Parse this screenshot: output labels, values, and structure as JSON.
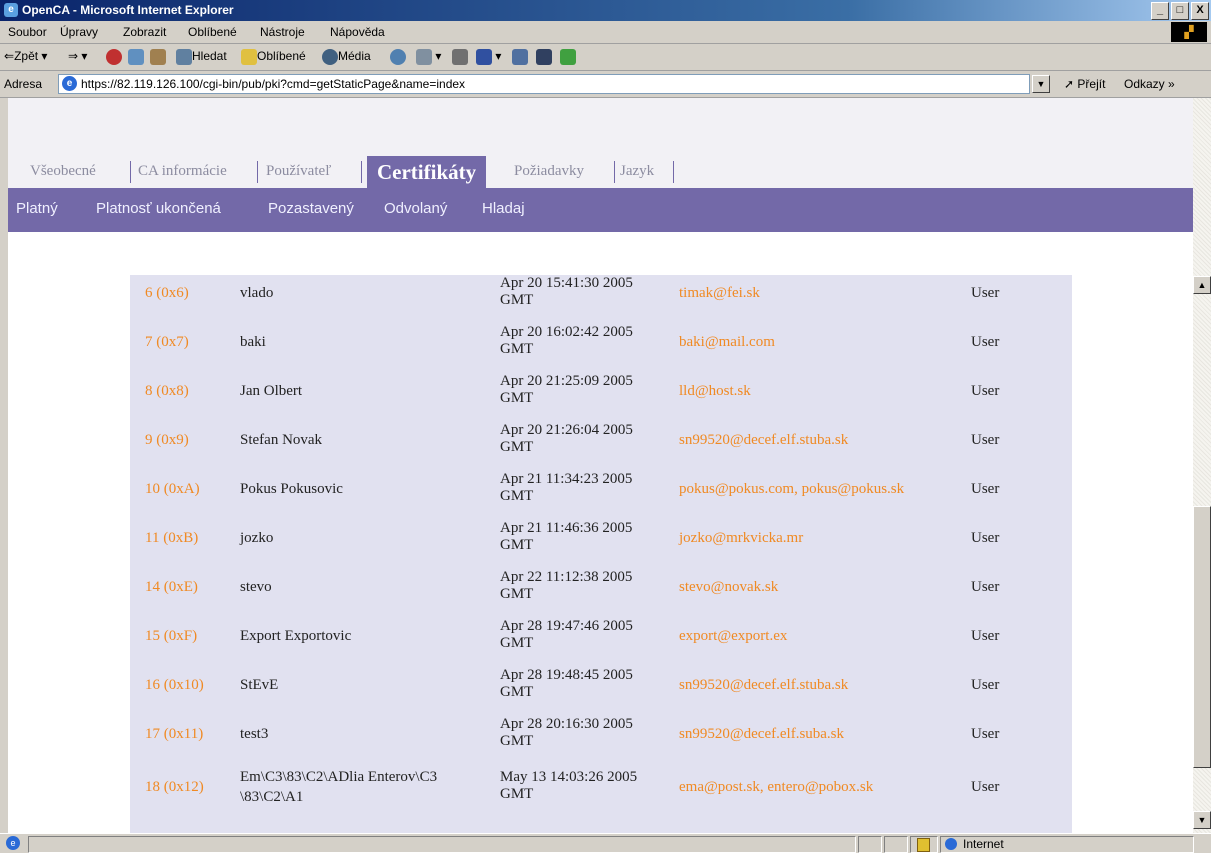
{
  "window": {
    "title": "OpenCA - Microsoft Internet Explorer",
    "min": "_",
    "max": "×",
    "restore": "□",
    "close": "X",
    "icon_glyph": "e"
  },
  "menu": [
    "Soubor",
    "Úpravy",
    "Zobrazit",
    "Oblíbené",
    "Nástroje",
    "Nápověda"
  ],
  "toolbar": {
    "back": "Zpět",
    "search": "Hledat",
    "favorites": "Oblíbené",
    "media": "Média"
  },
  "address": {
    "label": "Adresa",
    "url": "https://82.119.126.100/cgi-bin/pub/pki?cmd=getStaticPage&name=index",
    "go": "Přejít",
    "links": "Odkazy »"
  },
  "tabs": [
    "Všeobecné",
    "CA informácie",
    "Používateľ",
    "Certifikáty",
    "Požiadavky",
    "Jazyk"
  ],
  "active_tab": "Certifikáty",
  "subnav": [
    "Platný",
    "Platnosť ukončená",
    "Pozastavený",
    "Odvolaný",
    "Hladaj"
  ],
  "colors": {
    "nav": "#7369a8",
    "link": "#f08a24",
    "table_bg": "#e1e1f0"
  },
  "rows": [
    {
      "serial": "6 (0x6)",
      "name": "vlado",
      "date1": "Apr 20 15:41:30 2005",
      "date2": "GMT",
      "email": "timak@fei.sk",
      "role": "User"
    },
    {
      "serial": "7 (0x7)",
      "name": "baki",
      "date1": "Apr 20 16:02:42 2005",
      "date2": "GMT",
      "email": "baki@mail.com",
      "role": "User"
    },
    {
      "serial": "8 (0x8)",
      "name": "Jan Olbert",
      "date1": "Apr 20 21:25:09 2005",
      "date2": "GMT",
      "email": "lld@host.sk",
      "role": "User"
    },
    {
      "serial": "9 (0x9)",
      "name": "Stefan Novak",
      "date1": "Apr 20 21:26:04 2005",
      "date2": "GMT",
      "email": "sn99520@decef.elf.stuba.sk",
      "role": "User"
    },
    {
      "serial": "10 (0xA)",
      "name": "Pokus Pokusovic",
      "date1": "Apr 21 11:34:23 2005",
      "date2": "GMT",
      "email": "pokus@pokus.com, pokus@pokus.sk",
      "role": "User"
    },
    {
      "serial": "11 (0xB)",
      "name": "jozko",
      "date1": "Apr 21 11:46:36 2005",
      "date2": "GMT",
      "email": "jozko@mrkvicka.mr",
      "role": "User"
    },
    {
      "serial": "14 (0xE)",
      "name": "stevo",
      "date1": "Apr 22 11:12:38 2005",
      "date2": "GMT",
      "email": "stevo@novak.sk",
      "role": "User"
    },
    {
      "serial": "15 (0xF)",
      "name": "Export Exportovic",
      "date1": "Apr 28 19:47:46 2005",
      "date2": "GMT",
      "email": "export@export.ex",
      "role": "User"
    },
    {
      "serial": "16 (0x10)",
      "name": "StEvE",
      "date1": "Apr 28 19:48:45 2005",
      "date2": "GMT",
      "email": "sn99520@decef.elf.stuba.sk",
      "role": "User"
    },
    {
      "serial": "17 (0x11)",
      "name": "test3",
      "date1": "Apr 28 20:16:30 2005",
      "date2": "GMT",
      "email": "sn99520@decef.elf.suba.sk",
      "role": "User"
    },
    {
      "serial": "18 (0x12)",
      "name": "Em\\C3\\83\\C2\\ADlia Enterov\\C3",
      "name2": "\\83\\C2\\A1",
      "date1": "May 13 14:03:26 2005",
      "date2": "GMT",
      "email": "ema@post.sk, entero@pobox.sk",
      "role": "User"
    }
  ],
  "status": {
    "zone": "Internet"
  }
}
